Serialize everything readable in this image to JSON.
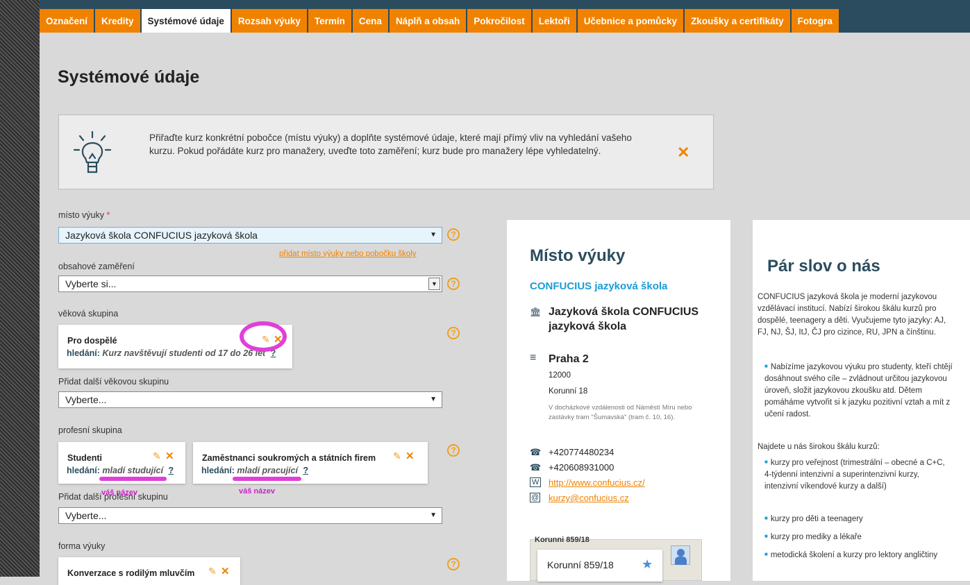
{
  "tabs": [
    {
      "label": "Označení"
    },
    {
      "label": "Kredity"
    },
    {
      "label": "Systémové údaje"
    },
    {
      "label": "Rozsah výuky"
    },
    {
      "label": "Termín"
    },
    {
      "label": "Cena"
    },
    {
      "label": "Náplň a obsah"
    },
    {
      "label": "Pokročilost"
    },
    {
      "label": "Lektoři"
    },
    {
      "label": "Učebnice a pomůcky"
    },
    {
      "label": "Zkoušky a certifikáty"
    },
    {
      "label": "Fotogra"
    }
  ],
  "page": {
    "title": "Systémové údaje"
  },
  "tip": {
    "text": "Přiřaďte kurz konkrétní pobočce (místu výuky) a doplňte systémové údaje, které mají přímý vliv na vyhledání vašeho kurzu. Pokud pořádáte kurz pro manažery, uveďte toto zaměření; kurz bude pro manažery lépe vyhledatelný.",
    "close": "✕"
  },
  "form": {
    "place_label": "místo výuky",
    "place_required": "*",
    "place_value": "Jazyková škola CONFUCIUS jazyková škola",
    "add_place_link": "přidat místo výuky nebo pobočku školy",
    "focus_label": "obsahové zaměření",
    "focus_value": "Vyberte si...",
    "age_label": "věková skupina",
    "age_card": {
      "title": "Pro dospělé",
      "search_label": "hledání:",
      "search_value": "Kurz navštěvují studenti od 17 do 26 let",
      "q": "?"
    },
    "add_age_label": "Přidat další věkovou skupinu",
    "add_age_value": "Vyberte...",
    "prof_label": "profesní skupina",
    "prof_cards": [
      {
        "title": "Studenti",
        "search_label": "hledání:",
        "search_value": "mladí studující",
        "q": "?"
      },
      {
        "title": "Zaměstnanci soukromých a státních firem",
        "search_label": "hledání:",
        "search_value": "mladí pracující",
        "q": "?"
      }
    ],
    "annotation": "váš název",
    "add_prof_label": "Přidat další profesní skupinu",
    "add_prof_value": "Vyberte...",
    "form_label": "forma výuky",
    "form_card": {
      "title": "Konverzace s rodilým mluvčím"
    },
    "help": "?"
  },
  "place_panel": {
    "heading": "Místo výuky",
    "school": "CONFUCIUS jazyková škola",
    "name": "Jazyková škola CONFUCIUS jazyková škola",
    "city": "Praha 2",
    "zip": "12000",
    "street": "Korunní 18",
    "note": "V docházkové vzdálenosti od Náměstí Míru nebo zastávky tram \"Šumavská\" (tram č. 10, 16).",
    "phone1": "+420774480234",
    "phone2": "+420608931000",
    "web": "http://www.confucius.cz/",
    "email": "kurzy@confucius.cz",
    "map_header": "Korunni 859/18",
    "map_label": "Korunní 859/18"
  },
  "about_panel": {
    "heading": "Pár slov o nás",
    "intro": "CONFUCIUS jazyková škola je moderní jazykovou vzdělávací institucí. Nabízí širokou škálu kurzů pro dospělé, teenagery a děti. Vyučujeme tyto jazyky: AJ, FJ, NJ, ŠJ, ItJ, ČJ pro cizince, RU, JPN a čínštinu.",
    "bullet1": "Nabízíme jazykovou výuku pro studenty, kteří chtějí dosáhnout svého cíle – zvládnout určitou jazykovou úroveň, složit jazykovou zkoušku atd. Dětem pomáháme vytvořit si k jazyku pozitivní vztah a mít z učení radost.",
    "mid": "Najdete u nás širokou škálu kurzů:",
    "bullet2": "kurzy pro veřejnost (trimestrální – obecné a C+C, 4-týdenní intenzivní a superintenzivní kurzy, intenzivní víkendové kurzy a další)",
    "bullet3": "kurzy pro děti a teenagery",
    "bullet4": "kurzy pro mediky a lékaře",
    "bullet5": "metodická školení a kurzy pro lektory angličtiny"
  },
  "colors": {
    "accent": "#f08200",
    "nav": "#2b4c5e",
    "link": "#1a9cd8",
    "marker": "#e040d8"
  }
}
